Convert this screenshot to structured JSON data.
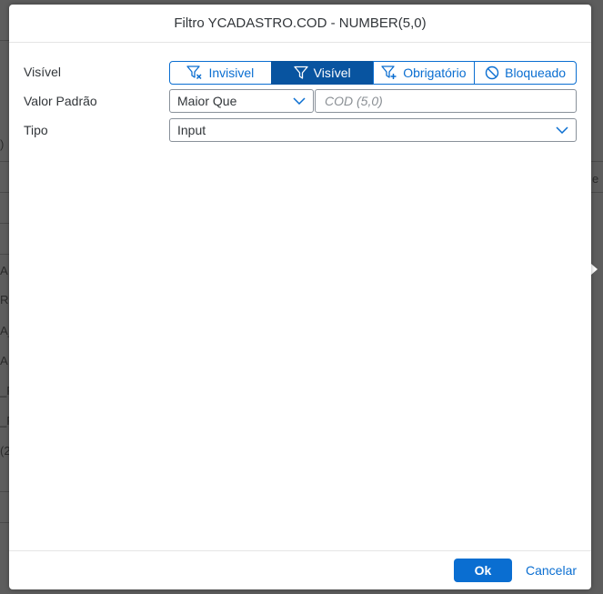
{
  "dialog": {
    "title": "Filtro YCADASTRO.COD - NUMBER(5,0)",
    "fields": {
      "visivel_label": "Visível",
      "valor_padrao_label": "Valor Padrão",
      "tipo_label": "Tipo"
    },
    "visibility_options": [
      {
        "label": "Invisivel",
        "icon": "filter-remove-icon",
        "active": false
      },
      {
        "label": "Visível",
        "icon": "filter-icon",
        "active": true
      },
      {
        "label": "Obrigatório",
        "icon": "filter-add-icon",
        "active": false
      },
      {
        "label": "Bloqueado",
        "icon": "blocked-icon",
        "active": false
      }
    ],
    "operator": {
      "selected": "Maior Que"
    },
    "default_value": {
      "value": "",
      "placeholder": "COD (5,0)"
    },
    "tipo": {
      "selected": "Input"
    },
    "footer": {
      "ok_label": "Ok",
      "cancel_label": "Cancelar"
    }
  },
  "background": {
    "fragments": [
      ")",
      "e",
      "A",
      "R",
      "A_",
      "A",
      "_F",
      "_F",
      "(2"
    ]
  },
  "colors": {
    "accent": "#0a6ed1",
    "active_segment": "#0854a0",
    "overlay": "#5d5d5d"
  }
}
